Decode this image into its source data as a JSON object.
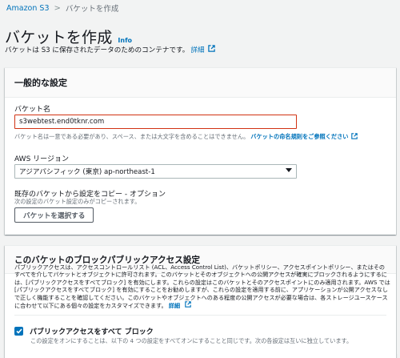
{
  "breadcrumb": {
    "root": "Amazon S3",
    "current": "バケットを作成"
  },
  "page": {
    "title": "バケットを作成",
    "info": "Info",
    "description": "バケットは S3 に保存されたデータのためのコンテナです。",
    "detail_link": "詳細"
  },
  "general": {
    "header": "一般的な設定",
    "bucket_name_label": "バケット名",
    "bucket_name_value": "s3webtest.end0tknr.com",
    "bucket_name_hint": "バケット名は一意である必要があり、スペース、または大文字を含めることはできません。",
    "naming_rules_link": "バケットの命名規則をご参照ください",
    "region_label": "AWS リージョン",
    "region_value": "アジアパシフィック (東京) ap-northeast-1",
    "copy_label": "既存のバケットから設定をコピー - オプション",
    "copy_hint": "次の設定のバケット設定のみがコピーされます。",
    "choose_bucket_button": "バケットを選択する"
  },
  "public_access": {
    "header": "このバケットのブロックパブリックアクセス設定",
    "description": "パブリックアクセスは、アクセスコントロールリスト (ACL、Access Control List)、バケットポリシー、アクセスポイントポリシー、またはそのすべてを介してバケットとオブジェクトに許可されます。このバケットとそのオブジェクトへの公開アクセスが確実にブロックされるようにするには、[パブリックアクセスをすべてブロック] を有効にします。これらの設定はこのバケットとそのアクセスポイントにのみ適用されます。AWS では [パブリックアクセスをすべてブロック] を有効にすることをお勧めしますが、これらの設定を適用する前に、アプリケーションが公開アクセスなしで正しく機能することを確認してください。このバケットやオブジェクトへのある程度の公開アクセスが必要な場合は、各ストレージユースケースに合わせて以下にある個々の設定をカスタマイズできます。",
    "detail_link": "詳細",
    "block_all_label": "パブリックアクセスをすべて ブロック",
    "block_all_checked": true,
    "block_all_hint": "この設定をオンにすることは、以下の 4 つの設定をすべてオンにすることと同じです。次の各設定は互いに独立しています。"
  },
  "colors": {
    "link": "#0073bb",
    "error_border": "#d13212",
    "background": "#f2f3f3"
  }
}
